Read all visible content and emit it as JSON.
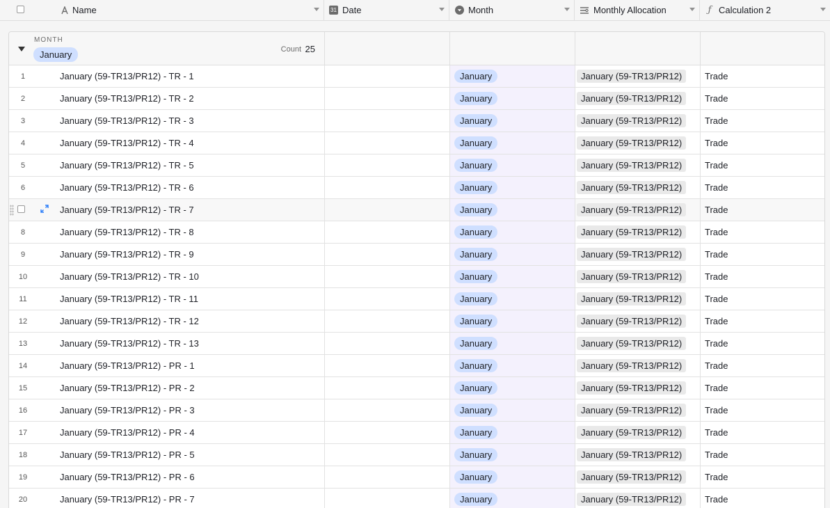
{
  "header": {
    "columns": [
      {
        "label": "Name",
        "icon": "text-field-icon"
      },
      {
        "label": "Date",
        "icon": "calendar-icon",
        "icon_text": "31"
      },
      {
        "label": "Month",
        "icon": "single-select-icon"
      },
      {
        "label": "Monthly Allocation",
        "icon": "link-field-icon"
      },
      {
        "label": "Calculation 2",
        "icon": "formula-icon"
      }
    ]
  },
  "group": {
    "field_label": "MONTH",
    "value": "January",
    "count_label": "Count",
    "count": "25"
  },
  "colors": {
    "accent_blue": "#2d7ff9",
    "month_pill": "#cfdfff",
    "month_column_tint": "#f4f1fd"
  },
  "rows": [
    {
      "num": "1",
      "name": "January (59-TR13/PR12) - TR - 1",
      "date": "",
      "month": "January",
      "alloc": "January (59-TR13/PR12)",
      "calc": "Trade"
    },
    {
      "num": "2",
      "name": "January (59-TR13/PR12) - TR - 2",
      "date": "",
      "month": "January",
      "alloc": "January (59-TR13/PR12)",
      "calc": "Trade"
    },
    {
      "num": "3",
      "name": "January (59-TR13/PR12) - TR - 3",
      "date": "",
      "month": "January",
      "alloc": "January (59-TR13/PR12)",
      "calc": "Trade"
    },
    {
      "num": "4",
      "name": "January (59-TR13/PR12) - TR - 4",
      "date": "",
      "month": "January",
      "alloc": "January (59-TR13/PR12)",
      "calc": "Trade"
    },
    {
      "num": "5",
      "name": "January (59-TR13/PR12) - TR - 5",
      "date": "",
      "month": "January",
      "alloc": "January (59-TR13/PR12)",
      "calc": "Trade"
    },
    {
      "num": "6",
      "name": "January (59-TR13/PR12) - TR - 6",
      "date": "",
      "month": "January",
      "alloc": "January (59-TR13/PR12)",
      "calc": "Trade"
    },
    {
      "num": "7",
      "name": "January (59-TR13/PR12) - TR - 7",
      "date": "",
      "month": "January",
      "alloc": "January (59-TR13/PR12)",
      "calc": "Trade"
    },
    {
      "num": "8",
      "name": "January (59-TR13/PR12) - TR - 8",
      "date": "",
      "month": "January",
      "alloc": "January (59-TR13/PR12)",
      "calc": "Trade"
    },
    {
      "num": "9",
      "name": "January (59-TR13/PR12) - TR - 9",
      "date": "",
      "month": "January",
      "alloc": "January (59-TR13/PR12)",
      "calc": "Trade"
    },
    {
      "num": "10",
      "name": "January (59-TR13/PR12) - TR - 10",
      "date": "",
      "month": "January",
      "alloc": "January (59-TR13/PR12)",
      "calc": "Trade"
    },
    {
      "num": "11",
      "name": "January (59-TR13/PR12) - TR - 11",
      "date": "",
      "month": "January",
      "alloc": "January (59-TR13/PR12)",
      "calc": "Trade"
    },
    {
      "num": "12",
      "name": "January (59-TR13/PR12) - TR - 12",
      "date": "",
      "month": "January",
      "alloc": "January (59-TR13/PR12)",
      "calc": "Trade"
    },
    {
      "num": "13",
      "name": "January (59-TR13/PR12) - TR - 13",
      "date": "",
      "month": "January",
      "alloc": "January (59-TR13/PR12)",
      "calc": "Trade"
    },
    {
      "num": "14",
      "name": "January (59-TR13/PR12) - PR - 1",
      "date": "",
      "month": "January",
      "alloc": "January (59-TR13/PR12)",
      "calc": "Trade"
    },
    {
      "num": "15",
      "name": "January (59-TR13/PR12) - PR - 2",
      "date": "",
      "month": "January",
      "alloc": "January (59-TR13/PR12)",
      "calc": "Trade"
    },
    {
      "num": "16",
      "name": "January (59-TR13/PR12) - PR - 3",
      "date": "",
      "month": "January",
      "alloc": "January (59-TR13/PR12)",
      "calc": "Trade"
    },
    {
      "num": "17",
      "name": "January (59-TR13/PR12) - PR - 4",
      "date": "",
      "month": "January",
      "alloc": "January (59-TR13/PR12)",
      "calc": "Trade"
    },
    {
      "num": "18",
      "name": "January (59-TR13/PR12) - PR - 5",
      "date": "",
      "month": "January",
      "alloc": "January (59-TR13/PR12)",
      "calc": "Trade"
    },
    {
      "num": "19",
      "name": "January (59-TR13/PR12) - PR - 6",
      "date": "",
      "month": "January",
      "alloc": "January (59-TR13/PR12)",
      "calc": "Trade"
    },
    {
      "num": "20",
      "name": "January (59-TR13/PR12) - PR - 7",
      "date": "",
      "month": "January",
      "alloc": "January (59-TR13/PR12)",
      "calc": "Trade"
    }
  ]
}
